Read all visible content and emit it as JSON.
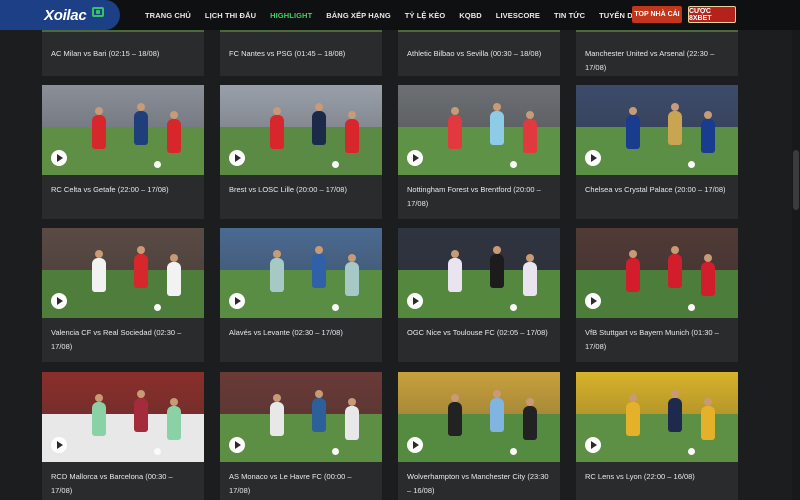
{
  "header": {
    "logo_text": "Xoilac",
    "nav": [
      {
        "label": "TRANG CHỦ",
        "active": false
      },
      {
        "label": "LỊCH THI ĐẤU",
        "active": false
      },
      {
        "label": "HIGHLIGHT",
        "active": true
      },
      {
        "label": "BẢNG XẾP HẠNG",
        "active": false
      },
      {
        "label": "TỶ LỆ KÈO",
        "active": false
      },
      {
        "label": "KQBD",
        "active": false
      },
      {
        "label": "LIVESCORE",
        "active": false
      },
      {
        "label": "TIN TỨC",
        "active": false
      },
      {
        "label": "TUYỂN DỤNG",
        "active": false
      }
    ],
    "btn_top": "TOP NHÀ CÁI",
    "btn_bet": "CƯỢC 8XBET"
  },
  "top_row": [
    {
      "title": "AC Milan vs Bari (02:15 – 18/08)"
    },
    {
      "title": "FC Nantes vs PSG (01:45 – 18/08)"
    },
    {
      "title": "Athletic Bilbao vs Sevilla (00:30 – 18/08)"
    },
    {
      "title": "Manchester United vs Arsenal (22:30 – 17/08)"
    }
  ],
  "videos": [
    {
      "title": "RC Celta vs Getafe (22:00 – 17/08)",
      "crowd": "#8a8f98",
      "pitch": "#5f8f45",
      "p1": "#d8262d",
      "p2": "#1f3f7a"
    },
    {
      "title": "Brest vs LOSC Lille (20:00 – 17/08)",
      "crowd": "#9aa0aa",
      "pitch": "#5a8a43",
      "p1": "#d8262d",
      "p2": "#1c2a4a"
    },
    {
      "title": "Nottingham Forest vs Brentford (20:00 – 17/08)",
      "crowd": "#6c6f73",
      "pitch": "#5d9247",
      "p1": "#e03a3f",
      "p2": "#8ecbe6"
    },
    {
      "title": "Chelsea vs Crystal Palace (20:00 – 17/08)",
      "crowd": "#3c4b6b",
      "pitch": "#5b8f46",
      "p1": "#1a3c8f",
      "p2": "#c9a552"
    },
    {
      "title": "Valencia CF vs Real Sociedad (02:30 – 17/08)",
      "crowd": "#5a4a44",
      "pitch": "#4f7d3b",
      "p1": "#f2f2f2",
      "p2": "#d8262d"
    },
    {
      "title": "Alavés vs Levante (02:30 – 17/08)",
      "crowd": "#4b6a91",
      "pitch": "#5a8d44",
      "p1": "#a7c9c5",
      "p2": "#2f60a8"
    },
    {
      "title": "OGC Nice vs Toulouse FC (02:05 – 17/08)",
      "crowd": "#2e3440",
      "pitch": "#55883f",
      "p1": "#e9e4ef",
      "p2": "#1c1c1c"
    },
    {
      "title": "VfB Stuttgart vs Bayern Munich (01:30 – 17/08)",
      "crowd": "#503a35",
      "pitch": "#4d7d3a",
      "p1": "#d21d2c",
      "p2": "#d21d2c"
    },
    {
      "title": "RCD Mallorca vs Barcelona (00:30 – 17/08)",
      "crowd": "#8a2e2b",
      "pitch": "#e8e8e8",
      "p1": "#8ad1a6",
      "p2": "#a42b3c"
    },
    {
      "title": "AS Monaco vs Le Havre FC (00:00 – 17/08)",
      "crowd": "#6a3a36",
      "pitch": "#5c8e44",
      "p1": "#e8e8e8",
      "p2": "#2d5f9a"
    },
    {
      "title": "Wolverhampton vs Manchester City (23:30 – 16/08)",
      "crowd": "#c8a13c",
      "pitch": "#558b40",
      "p1": "#222222",
      "p2": "#7fb5e0"
    },
    {
      "title": "RC Lens vs Lyon (22:00 – 16/08)",
      "crowd": "#d8b22a",
      "pitch": "#5d8f44",
      "p1": "#e3b22a",
      "p2": "#1d2a4d"
    }
  ]
}
